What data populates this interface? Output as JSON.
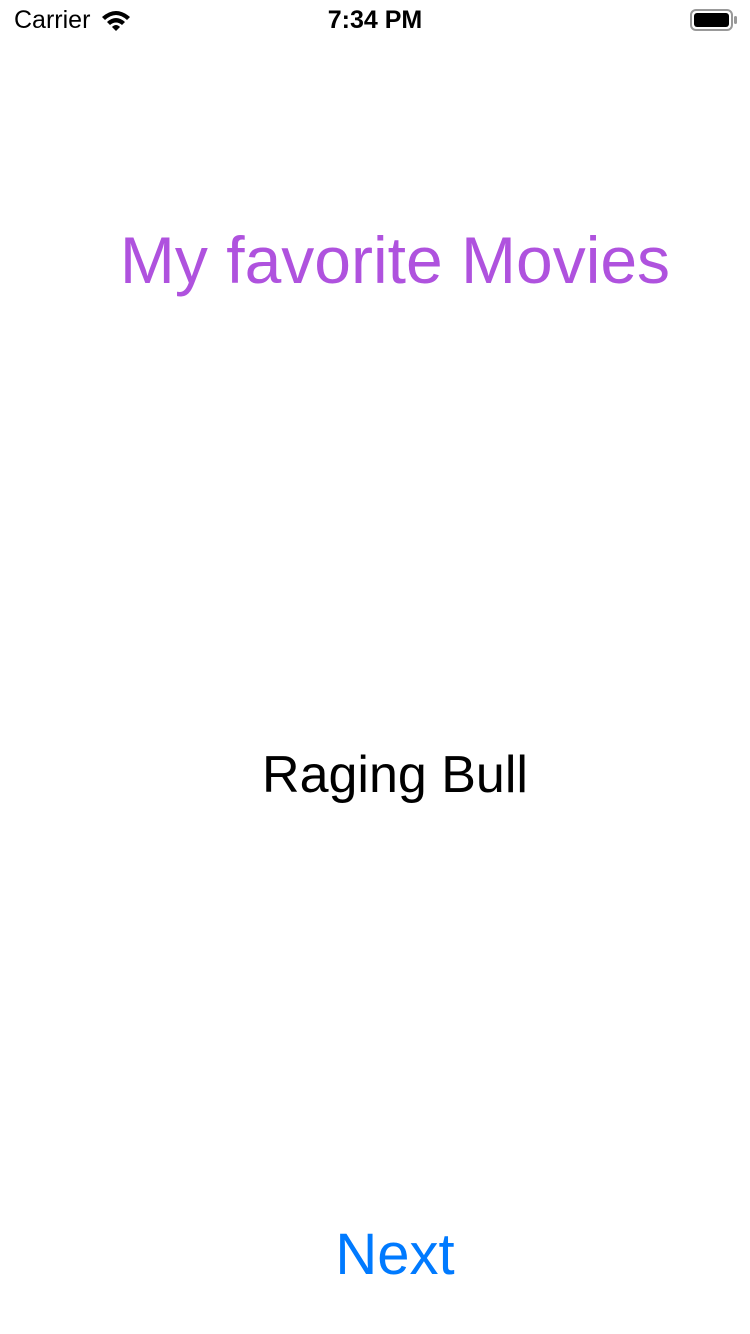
{
  "status_bar": {
    "carrier": "Carrier",
    "time": "7:34 PM",
    "icons": [
      "wifi-icon",
      "battery-icon"
    ]
  },
  "title": "My favorite Movies",
  "movie_name": "Raging Bull",
  "next_button": "Next",
  "colors": {
    "title": "#af52de",
    "button": "#007aff",
    "text": "#000000",
    "background": "#ffffff"
  }
}
